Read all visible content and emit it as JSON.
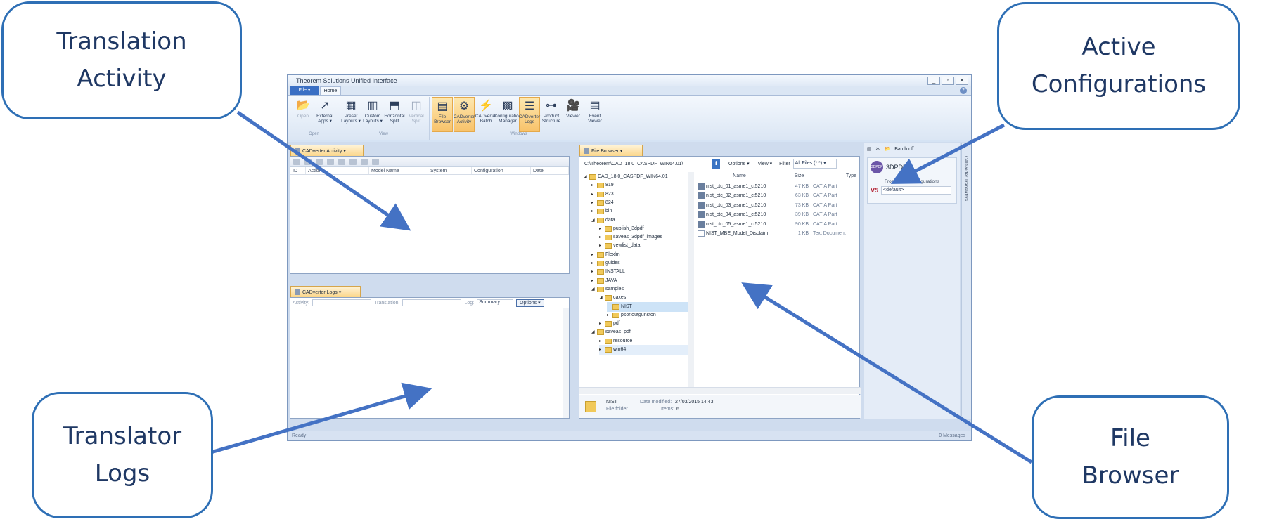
{
  "callouts": {
    "activity": [
      "Translation",
      "Activity"
    ],
    "config": [
      "Active",
      "Configurations"
    ],
    "logs": [
      "Translator",
      "Logs"
    ],
    "browser": [
      "File",
      "Browser"
    ]
  },
  "colors": {
    "callout_border": "#2e6fb5",
    "callout_text": "#1f3864",
    "arrow": "#4472c4",
    "active_button": "#f8c26a"
  },
  "app": {
    "title": "Theorem Solutions Unified Interface",
    "window_buttons": [
      "_",
      "▫",
      "✕"
    ],
    "tabs": {
      "file": "File ▾",
      "home": "Home"
    },
    "ribbon": {
      "groups": [
        {
          "label": "Open",
          "buttons": [
            {
              "icon": "open-folder-icon",
              "glyph": "📂",
              "label": "Open",
              "disabled": true
            },
            {
              "icon": "external-apps-icon",
              "glyph": "↗",
              "label": "External Apps ▾",
              "disabled": false
            }
          ]
        },
        {
          "label": "View",
          "buttons": [
            {
              "icon": "preset-layouts-icon",
              "glyph": "▦",
              "label": "Preset Layouts ▾"
            },
            {
              "icon": "custom-layouts-icon",
              "glyph": "▥",
              "label": "Custom Layouts ▾"
            },
            {
              "icon": "horizontal-split-icon",
              "glyph": "⬒",
              "label": "Horizontal Split"
            },
            {
              "icon": "vertical-split-icon",
              "glyph": "◫",
              "label": "Vertical Split",
              "disabled": true
            }
          ]
        },
        {
          "label": "Windows",
          "buttons": [
            {
              "icon": "file-browser-icon",
              "glyph": "▤",
              "label": "File Browser",
              "active": true
            },
            {
              "icon": "cadverter-activity-icon",
              "glyph": "⚙",
              "label": "CADverter Activity",
              "active": true
            },
            {
              "icon": "cadverter-batch-icon",
              "glyph": "⚡",
              "label": "CADverter Batch"
            },
            {
              "icon": "configuration-manager-icon",
              "glyph": "▩",
              "label": "Configuration Manager"
            },
            {
              "icon": "cadverter-logs-icon",
              "glyph": "☰",
              "label": "CADverter Logs",
              "active": true
            },
            {
              "icon": "product-structure-icon",
              "glyph": "⊶",
              "label": "Product Structure"
            },
            {
              "icon": "viewer-icon",
              "glyph": "🎥",
              "label": "Viewer"
            },
            {
              "icon": "event-viewer-icon",
              "glyph": "▤",
              "label": "Event Viewer"
            }
          ]
        }
      ]
    },
    "activity_panel": {
      "tab": "CADverter Activity ▾",
      "columns": [
        "ID",
        "Action",
        "Model Name",
        "System",
        "Configuration",
        "Date"
      ]
    },
    "logs_panel": {
      "tab": "CADverter Logs ▾",
      "activity_label": "Activity:",
      "translation_label": "Translation:",
      "log_label": "Log:",
      "log_value": "Summary",
      "options": "Options ▾"
    },
    "file_browser": {
      "tab": "File Browser ▾",
      "path": "C:\\Theorem\\CAD_18.0_CASPDF_WIN64.01\\",
      "options": "Options ▾",
      "view": "View ▾",
      "filter_label": "Filter",
      "filter_value": "All Files (*.*) ▾",
      "tree": [
        {
          "label": "CAD_18.0_CASPDF_WIN64.01",
          "depth": 0,
          "exp": "◢"
        },
        {
          "label": "819",
          "depth": 1,
          "exp": "▸"
        },
        {
          "label": "823",
          "depth": 1,
          "exp": "▸"
        },
        {
          "label": "824",
          "depth": 1,
          "exp": "▸"
        },
        {
          "label": "bin",
          "depth": 1,
          "exp": "▸"
        },
        {
          "label": "data",
          "depth": 1,
          "exp": "◢"
        },
        {
          "label": "publish_3dpdf",
          "depth": 2,
          "exp": "▸"
        },
        {
          "label": "saveas_3dpdf_images",
          "depth": 2,
          "exp": "▸"
        },
        {
          "label": "vewlist_data",
          "depth": 2,
          "exp": "▸"
        },
        {
          "label": "Flexlm",
          "depth": 1,
          "exp": "▸"
        },
        {
          "label": "guides",
          "depth": 1,
          "exp": "▸"
        },
        {
          "label": "INSTALL",
          "depth": 1,
          "exp": "▸"
        },
        {
          "label": "JAVA",
          "depth": 1,
          "exp": "▸"
        },
        {
          "label": "samples",
          "depth": 1,
          "exp": "◢"
        },
        {
          "label": "caxes",
          "depth": 2,
          "exp": "◢"
        },
        {
          "label": "NIST",
          "depth": 3,
          "exp": "",
          "selected": true
        },
        {
          "label": "psor.outgunston",
          "depth": 3,
          "exp": "▸"
        },
        {
          "label": "pdf",
          "depth": 2,
          "exp": "▸"
        },
        {
          "label": "saveas_pdf",
          "depth": 1,
          "exp": "◢"
        },
        {
          "label": "resource",
          "depth": 2,
          "exp": "▸"
        },
        {
          "label": "win64",
          "depth": 2,
          "exp": "▸",
          "hover": true
        }
      ],
      "columns": [
        "Name",
        "Size",
        "Type"
      ],
      "files": [
        {
          "name": "nist_ctc_01_asme1_ct5210",
          "size": "47 KB",
          "type": "CATIA Part",
          "kind": "part"
        },
        {
          "name": "nist_ctc_02_asme1_ct5210",
          "size": "63 KB",
          "type": "CATIA Part",
          "kind": "part"
        },
        {
          "name": "nist_ctc_03_asme1_ct5210",
          "size": "73 KB",
          "type": "CATIA Part",
          "kind": "part"
        },
        {
          "name": "nist_ctc_04_asme1_ct5210",
          "size": "39 KB",
          "type": "CATIA Part",
          "kind": "part"
        },
        {
          "name": "nist_ctc_05_asme1_ct5210",
          "size": "90 KB",
          "type": "CATIA Part",
          "kind": "part"
        },
        {
          "name": "NIST_MBE_Model_Disclaim",
          "size": "1 KB",
          "type": "Text Document",
          "kind": "text"
        }
      ],
      "details": {
        "name": "NIST",
        "kind": "File folder",
        "modified_label": "Date modified:",
        "modified": "27/03/2015 14:43",
        "items_label": "Items:",
        "items": "6"
      }
    },
    "config_panel": {
      "batch_off": "Batch off",
      "plugin_logo": "3DPDF",
      "plugin": "3DPDF",
      "from_label": "From Active Configurations",
      "source": "V5",
      "config_value": "<default>",
      "side_tab": "CADverter Translators"
    },
    "status": {
      "left": "Ready",
      "right": "0 Messages"
    }
  }
}
